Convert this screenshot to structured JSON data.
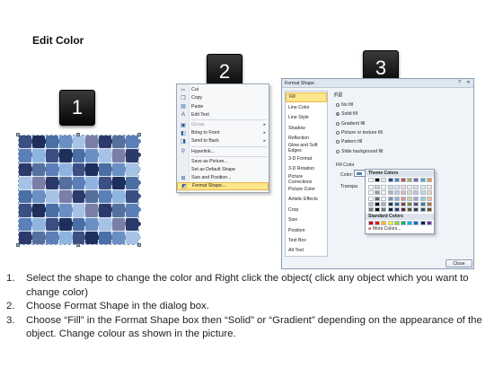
{
  "title": "Edit Color",
  "badges": [
    "1",
    "2",
    "3"
  ],
  "context_menu": {
    "items": [
      {
        "label": "Cut",
        "icon": "scissors-icon",
        "disabled": false
      },
      {
        "label": "Copy",
        "icon": "copy-icon",
        "disabled": false
      },
      {
        "label": "Paste",
        "icon": "paste-icon",
        "disabled": false
      },
      {
        "label": "Edit Text",
        "icon": "edit-text-icon",
        "disabled": false
      },
      {
        "label": "Group",
        "icon": "group-icon",
        "disabled": true,
        "submenu": true
      },
      {
        "label": "Bring to Front",
        "icon": "bring-front-icon",
        "disabled": false,
        "submenu": true
      },
      {
        "label": "Send to Back",
        "icon": "send-back-icon",
        "disabled": false,
        "submenu": true
      },
      {
        "label": "Hyperlink...",
        "icon": "hyperlink-icon",
        "disabled": false
      },
      {
        "label": "Save as Picture...",
        "icon": "",
        "disabled": false
      },
      {
        "label": "Set as Default Shape",
        "icon": "",
        "disabled": false
      },
      {
        "label": "Size and Position...",
        "icon": "size-icon",
        "disabled": false
      },
      {
        "label": "Format Shape...",
        "icon": "format-shape-icon",
        "disabled": false,
        "highlighted": true
      }
    ]
  },
  "dialog": {
    "title": "Format Shape",
    "title_buttons": [
      "?",
      "✕"
    ],
    "nav": [
      "Fill",
      "Line Color",
      "Line Style",
      "Shadow",
      "Reflection",
      "Glow and Soft Edges",
      "3-D Format",
      "3-D Rotation",
      "Picture Corrections",
      "Picture Color",
      "Artistic Effects",
      "Crop",
      "Size",
      "Position",
      "Text Box",
      "Alt Text"
    ],
    "selected_nav": "Fill",
    "pane_title": "Fill",
    "options": [
      {
        "label": "No fill",
        "checked": false
      },
      {
        "label": "Solid fill",
        "checked": true
      },
      {
        "label": "Gradient fill",
        "checked": false
      },
      {
        "label": "Picture or texture fill",
        "checked": false
      },
      {
        "label": "Pattern fill",
        "checked": false
      },
      {
        "label": "Slide background fill",
        "checked": false
      }
    ],
    "fill_color_label": "Fill Color",
    "color_label": "Color:",
    "transparency_label": "Transpa",
    "close_label": "Close"
  },
  "color_picker": {
    "theme_label": "Theme Colors",
    "standard_label": "Standard Colors",
    "more_label": "More Colors...",
    "theme_top": [
      "#ffffff",
      "#000000",
      "#eeece1",
      "#1f497d",
      "#4f81bd",
      "#c0504d",
      "#9bbb59",
      "#8064a2",
      "#4bacc6",
      "#f79646"
    ],
    "standard": [
      "#c00000",
      "#ff0000",
      "#ffc000",
      "#ffff00",
      "#92d050",
      "#00b050",
      "#00b0f0",
      "#0070c0",
      "#002060",
      "#7030a0"
    ]
  },
  "puzzle_colors": [
    "#3b4f82",
    "#6a8fc4",
    "#2c3a6b",
    "#8fb4df",
    "#4a6fa5",
    "#7a7fa8",
    "#5b7fb8",
    "#1f2f5c",
    "#a6c3e6",
    "#56709e"
  ],
  "steps": [
    "Select the shape to change the color and Right click the object( click any object which you want to change color)",
    "Choose Format Shape in the dialog box.",
    "Choose “Fill” in the Format Shape box then “Solid” or “Gradient” depending on the appearance of the object. Change colour as shown in the picture."
  ]
}
